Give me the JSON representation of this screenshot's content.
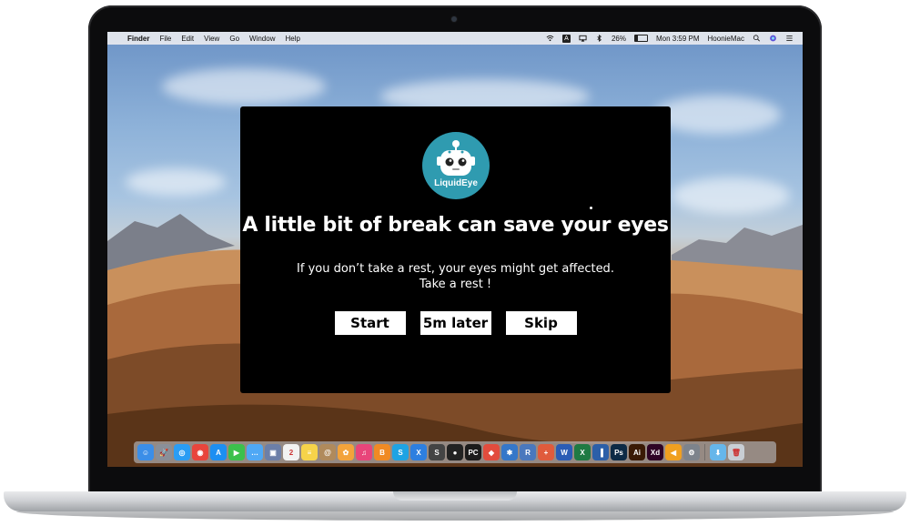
{
  "menubar": {
    "apple_glyph": "",
    "items": [
      "Finder",
      "File",
      "Edit",
      "View",
      "Go",
      "Window",
      "Help"
    ],
    "input_source": "A",
    "battery_percent": 0.26,
    "battery_text": "26%",
    "clock": "Mon 3:59 PM",
    "computer_name": "HoonieMac"
  },
  "popup": {
    "logo_name": "LiquidEye",
    "headline": "A little bit of break can save your eyes",
    "message_line1": "If you don’t take a rest, your eyes might get affected.",
    "message_line2": "Take a rest !",
    "buttons": {
      "start": "Start",
      "later": "5m later",
      "skip": "Skip"
    }
  },
  "dock": {
    "apps": [
      {
        "icon": "finder-icon",
        "color": "#3b8ee8",
        "glyph": "☺"
      },
      {
        "icon": "launchpad-icon",
        "color": "#8a8f98",
        "glyph": "🚀"
      },
      {
        "icon": "safari-icon",
        "color": "#2a9df4",
        "glyph": "◎"
      },
      {
        "icon": "chrome-icon",
        "color": "#e8453c",
        "glyph": "◉"
      },
      {
        "icon": "app-store-icon",
        "color": "#1d8ff2",
        "glyph": "A"
      },
      {
        "icon": "facetime-icon",
        "color": "#3cc04c",
        "glyph": "▶"
      },
      {
        "icon": "messages-icon",
        "color": "#4fa8f5",
        "glyph": "…"
      },
      {
        "icon": "preview-icon",
        "color": "#6c7fa8",
        "glyph": "▣"
      },
      {
        "icon": "calendar-icon",
        "color": "#f2f2f2",
        "glyph": "2"
      },
      {
        "icon": "notes-icon",
        "color": "#f6d34a",
        "glyph": "≡"
      },
      {
        "icon": "contacts-icon",
        "color": "#b08a5c",
        "glyph": "@"
      },
      {
        "icon": "photos-icon",
        "color": "#f3a33b",
        "glyph": "✿"
      },
      {
        "icon": "itunes-icon",
        "color": "#e8457a",
        "glyph": "♫"
      },
      {
        "icon": "books-icon",
        "color": "#f08a24",
        "glyph": "B"
      },
      {
        "icon": "skype-icon",
        "color": "#1ea3e3",
        "glyph": "S"
      },
      {
        "icon": "xcode-icon",
        "color": "#2d7fe0",
        "glyph": "X"
      },
      {
        "icon": "sublime-icon",
        "color": "#444",
        "glyph": "S"
      },
      {
        "icon": "github-icon",
        "color": "#222",
        "glyph": "●"
      },
      {
        "icon": "pycharm-icon",
        "color": "#1b1b1b",
        "glyph": "PC"
      },
      {
        "icon": "git-icon",
        "color": "#e24c3d",
        "glyph": "◆"
      },
      {
        "icon": "network-icon",
        "color": "#3577c9",
        "glyph": "✱"
      },
      {
        "icon": "r-icon",
        "color": "#4a78bd",
        "glyph": "R"
      },
      {
        "icon": "tableau-icon",
        "color": "#e05b3c",
        "glyph": "+"
      },
      {
        "icon": "word-icon",
        "color": "#2b5cb5",
        "glyph": "W"
      },
      {
        "icon": "excel-icon",
        "color": "#1f7a43",
        "glyph": "X"
      },
      {
        "icon": "powershell-icon",
        "color": "#2c5fa8",
        "glyph": "▐"
      },
      {
        "icon": "photoshop-icon",
        "color": "#0d2a45",
        "glyph": "Ps"
      },
      {
        "icon": "illustrator-icon",
        "color": "#3a1a05",
        "glyph": "Ai"
      },
      {
        "icon": "xd-icon",
        "color": "#2e0425",
        "glyph": "Xd"
      },
      {
        "icon": "fish-icon",
        "color": "#f0a020",
        "glyph": "◀"
      },
      {
        "icon": "system-preferences-icon",
        "color": "#7d838c",
        "glyph": "⚙"
      },
      {
        "icon": "downloads-folder-icon",
        "color": "#66b6ea",
        "glyph": "⬇"
      },
      {
        "icon": "trash-icon",
        "color": "#c9ced4",
        "glyph": "🗑"
      }
    ]
  }
}
